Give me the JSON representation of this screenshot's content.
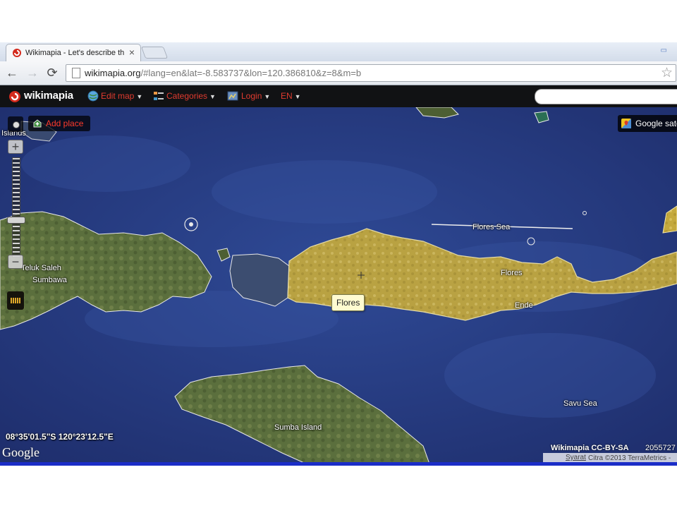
{
  "browser": {
    "tab_title": "Wikimapia - Let's describe th",
    "tab_close": "×",
    "url_host": "wikimapia.org",
    "url_rest": "/#lang=en&lat=-8.583737&lon=120.386810&z=8&m=b",
    "icons": [
      "back-arrow-icon",
      "forward-arrow-icon",
      "reload-icon",
      "page-icon",
      "bookmark-star-icon"
    ]
  },
  "wikimapia_bar": {
    "logo_text": "wikimapia",
    "menu": {
      "edit_map": "Edit map",
      "categories": "Categories",
      "login": "Login",
      "language": "EN"
    },
    "search_placeholder": ""
  },
  "map_controls": {
    "add_place": "Add place",
    "google_satellite": "Google satellite",
    "zoom_in": "+",
    "zoom_out": "−",
    "zoom_level": 8
  },
  "map_labels": {
    "flores_sea": "Flores Sea",
    "flores": "Flores",
    "ende": "Ende",
    "teluk_saleh": "Teluk Saleh",
    "sumbawa": "Sumbawa",
    "sumba_island": "Sumba Island",
    "savu_sea": "Savu Sea",
    "islands": "Islands"
  },
  "tooltip": "Flores",
  "coordinates": "08°35'01.5\"S 120°23'12.5\"E",
  "google_logo": "Google",
  "license": "Wikimapia CC-BY-SA",
  "scale_number": "2055727",
  "attribution": {
    "imagery": "Citra ©2013 TerraMetrics - ",
    "terms_link": "Syarat"
  },
  "colors": {
    "ocean": "#2a3f8a",
    "land": "#5a6e3c",
    "highlight": "#c8ad3c",
    "menu_text": "#e03b2f",
    "bar": "#111214"
  }
}
